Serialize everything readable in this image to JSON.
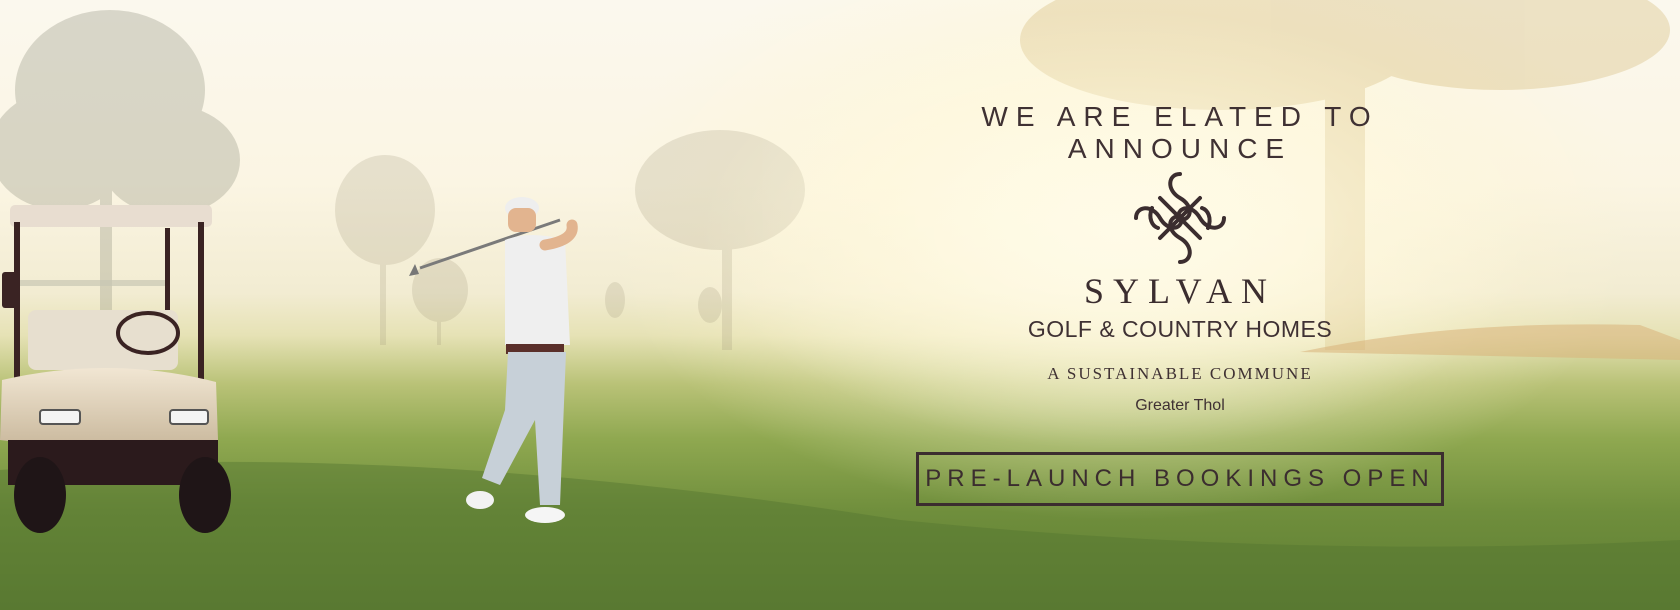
{
  "hero": {
    "announcement": "WE ARE ELATED TO ANNOUNCE",
    "brand_name": "SYLVAN",
    "sub_brand": "GOLF & COUNTRY HOMES",
    "tagline": "A SUSTAINABLE COMMUNE",
    "location": "Greater Thol",
    "cta_label": "PRE-LAUNCH BOOKINGS OPEN"
  },
  "colors": {
    "text": "#3b2d2f",
    "sky": "#fbf8ee",
    "grass": "#6f8e3c"
  },
  "icons": {
    "logo": "sylvan-knot-logo"
  }
}
